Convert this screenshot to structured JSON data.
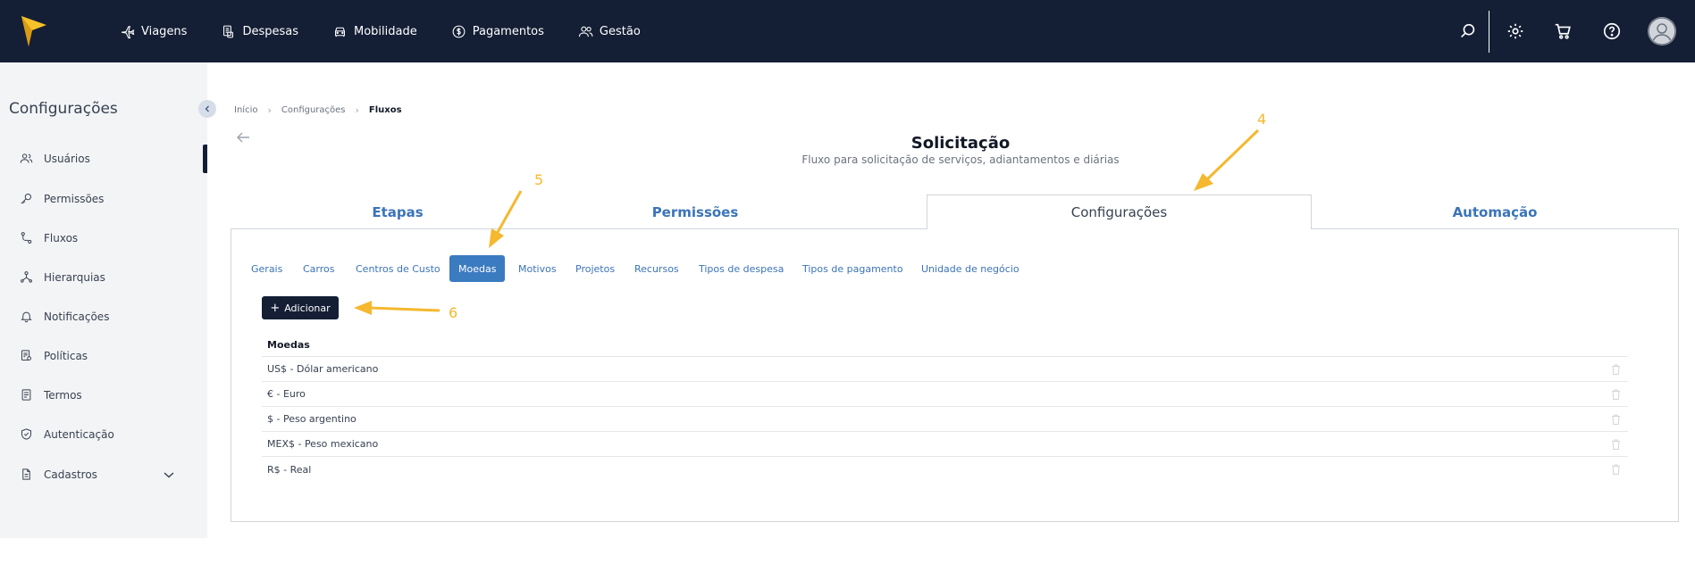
{
  "nav": {
    "items": [
      {
        "label": "Viagens",
        "icon": "airplane-icon"
      },
      {
        "label": "Despesas",
        "icon": "receipt-icon"
      },
      {
        "label": "Mobilidade",
        "icon": "car-icon"
      },
      {
        "label": "Pagamentos",
        "icon": "dollar-icon"
      },
      {
        "label": "Gestão",
        "icon": "users-icon"
      }
    ]
  },
  "sidebar": {
    "title": "Configurações",
    "items": [
      {
        "label": "Usuários",
        "icon": "users-icon"
      },
      {
        "label": "Permissões",
        "icon": "key-icon"
      },
      {
        "label": "Fluxos",
        "icon": "flow-icon"
      },
      {
        "label": "Hierarquias",
        "icon": "hierarchy-icon"
      },
      {
        "label": "Notificações",
        "icon": "bell-icon"
      },
      {
        "label": "Políticas",
        "icon": "policy-icon"
      },
      {
        "label": "Termos",
        "icon": "document-icon"
      },
      {
        "label": "Autenticação",
        "icon": "shield-icon"
      },
      {
        "label": "Cadastros",
        "icon": "file-icon"
      }
    ]
  },
  "breadcrumb": {
    "items": [
      "Início",
      "Configurações",
      "Fluxos"
    ]
  },
  "page": {
    "title": "Solicitação",
    "subtitle": "Fluxo para solicitação de serviços, adiantamentos e diárias"
  },
  "tabs": [
    {
      "label": "Etapas"
    },
    {
      "label": "Permissões"
    },
    {
      "label": "Configurações",
      "active": true
    },
    {
      "label": "Automação"
    }
  ],
  "subtabs": [
    {
      "label": "Gerais"
    },
    {
      "label": "Carros"
    },
    {
      "label": "Centros de Custo"
    },
    {
      "label": "Moedas",
      "active": true
    },
    {
      "label": "Motivos"
    },
    {
      "label": "Projetos"
    },
    {
      "label": "Recursos"
    },
    {
      "label": "Tipos de despesa"
    },
    {
      "label": "Tipos de pagamento"
    },
    {
      "label": "Unidade de negócio"
    }
  ],
  "add_button": {
    "label": "Adicionar"
  },
  "table": {
    "header": "Moedas",
    "rows": [
      "US$ - Dólar americano",
      "€ - Euro",
      "$ - Peso argentino",
      "MEX$ - Peso mexicano",
      "R$ - Real"
    ]
  },
  "annotations": [
    "4",
    "5",
    "6"
  ],
  "colors": {
    "topbar": "#141f35",
    "accent": "#3b7bc0",
    "annotation": "#f5b82e",
    "logo": "#f7c12a"
  }
}
